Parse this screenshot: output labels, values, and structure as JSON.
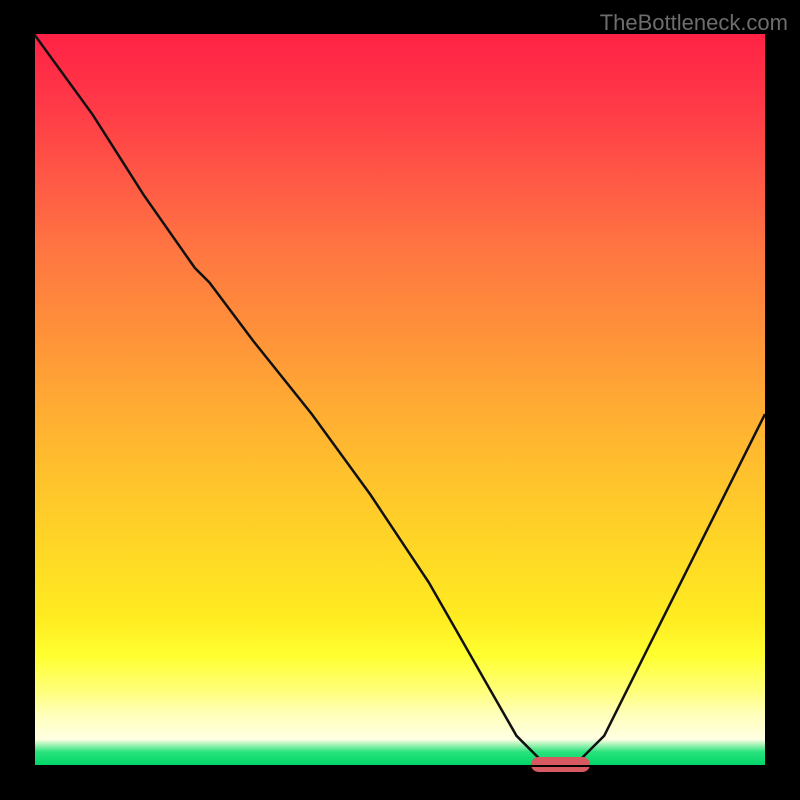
{
  "watermark": "TheBottleneck.com",
  "colors": {
    "marker": "#d75a62",
    "curve": "#111111",
    "background_frame": "#000000"
  },
  "chart_data": {
    "type": "line",
    "title": "",
    "xlabel": "",
    "ylabel": "",
    "xlim": [
      0,
      100
    ],
    "ylim": [
      0,
      100
    ],
    "x": [
      0,
      8,
      15,
      22,
      24,
      30,
      38,
      46,
      54,
      58,
      62,
      66,
      70,
      74,
      78,
      84,
      90,
      100
    ],
    "values": [
      100,
      89,
      78,
      68,
      66,
      58,
      48,
      37,
      25,
      18,
      11,
      4,
      0,
      0,
      4,
      16,
      28,
      48
    ],
    "marker": {
      "x_start": 68,
      "x_end": 76,
      "y": 0
    },
    "gradient_scale": {
      "top": "bad",
      "bottom": "good"
    }
  }
}
